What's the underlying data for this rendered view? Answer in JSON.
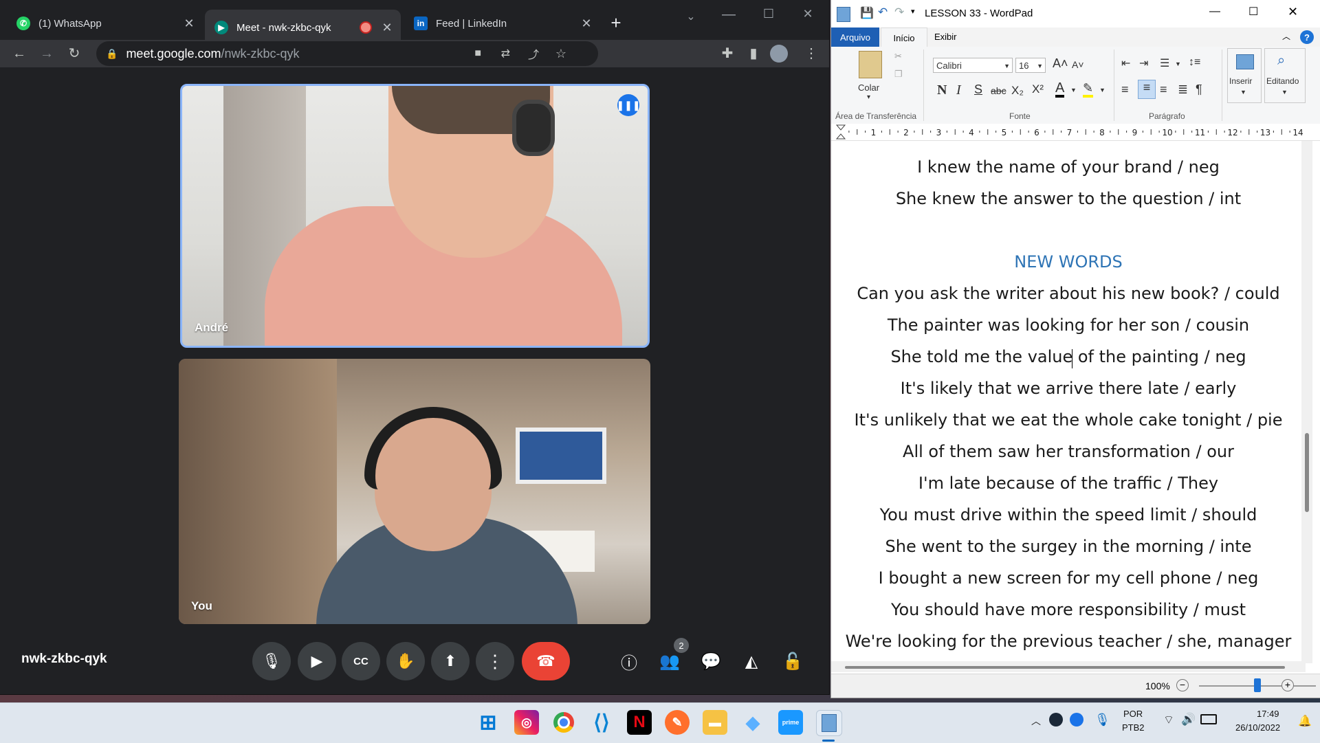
{
  "browser": {
    "tabs": [
      {
        "label": "(1) WhatsApp",
        "icon": "whatsapp-icon",
        "active": false
      },
      {
        "label": "Meet - nwk-zkbc-qyk",
        "icon": "google-meet-icon",
        "active": true
      },
      {
        "label": "Feed | LinkedIn",
        "icon": "linkedin-icon",
        "active": false
      }
    ],
    "url_host": "meet.google.com",
    "url_path": "/nwk-zkbc-qyk"
  },
  "meet": {
    "meeting_code": "nwk-zkbc-qyk",
    "participants": [
      {
        "name": "André",
        "speaking": true
      },
      {
        "name": "You",
        "speaking": false
      }
    ],
    "people_count": "2"
  },
  "wordpad": {
    "title": "LESSON 33 - WordPad",
    "tabs": [
      "Arquivo",
      "Início",
      "Exibir"
    ],
    "clipboard": {
      "paste_label": "Colar",
      "group_label": "Área de Transferência"
    },
    "font": {
      "family": "Calibri",
      "size": "16",
      "group_label": "Fonte",
      "bold": "N",
      "italic": "I",
      "strike": "S",
      "abc": "abc"
    },
    "paragraph": {
      "group_label": "Parágrafo"
    },
    "insert_label": "Inserir",
    "editing_label": "Editando",
    "ruler_numbers": [
      "1",
      "2",
      "3",
      "4",
      "5",
      "6",
      "7",
      "8",
      "9",
      "10",
      "11",
      "12",
      "13",
      "14"
    ],
    "lines": [
      "I knew the name of your brand / neg",
      "She knew the answer to the question / int",
      "",
      "NEW WORDS",
      "Can you ask the writer about his new book? / could",
      "The painter was looking for her son / cousin",
      "She told me the value of the painting  / neg",
      "It's likely that we arrive there late / early",
      "It's unlikely that we eat the whole cake tonight / pie",
      "All of them saw her transformation / our",
      "I'm late because of the traffic / They",
      "You must drive within the speed limit / should",
      "She went to the surgey in the morning / inte",
      "I bought a new screen for my cell phone / neg",
      "You should have more responsibility / must",
      "We're looking for the previous teacher / she, manager"
    ],
    "zoom": "100%",
    "zoom_level_fraction": 0.5
  },
  "taskbar": {
    "lang_top": "POR",
    "lang_bottom": "PTB2",
    "time": "17:49",
    "date": "26/10/2022"
  }
}
